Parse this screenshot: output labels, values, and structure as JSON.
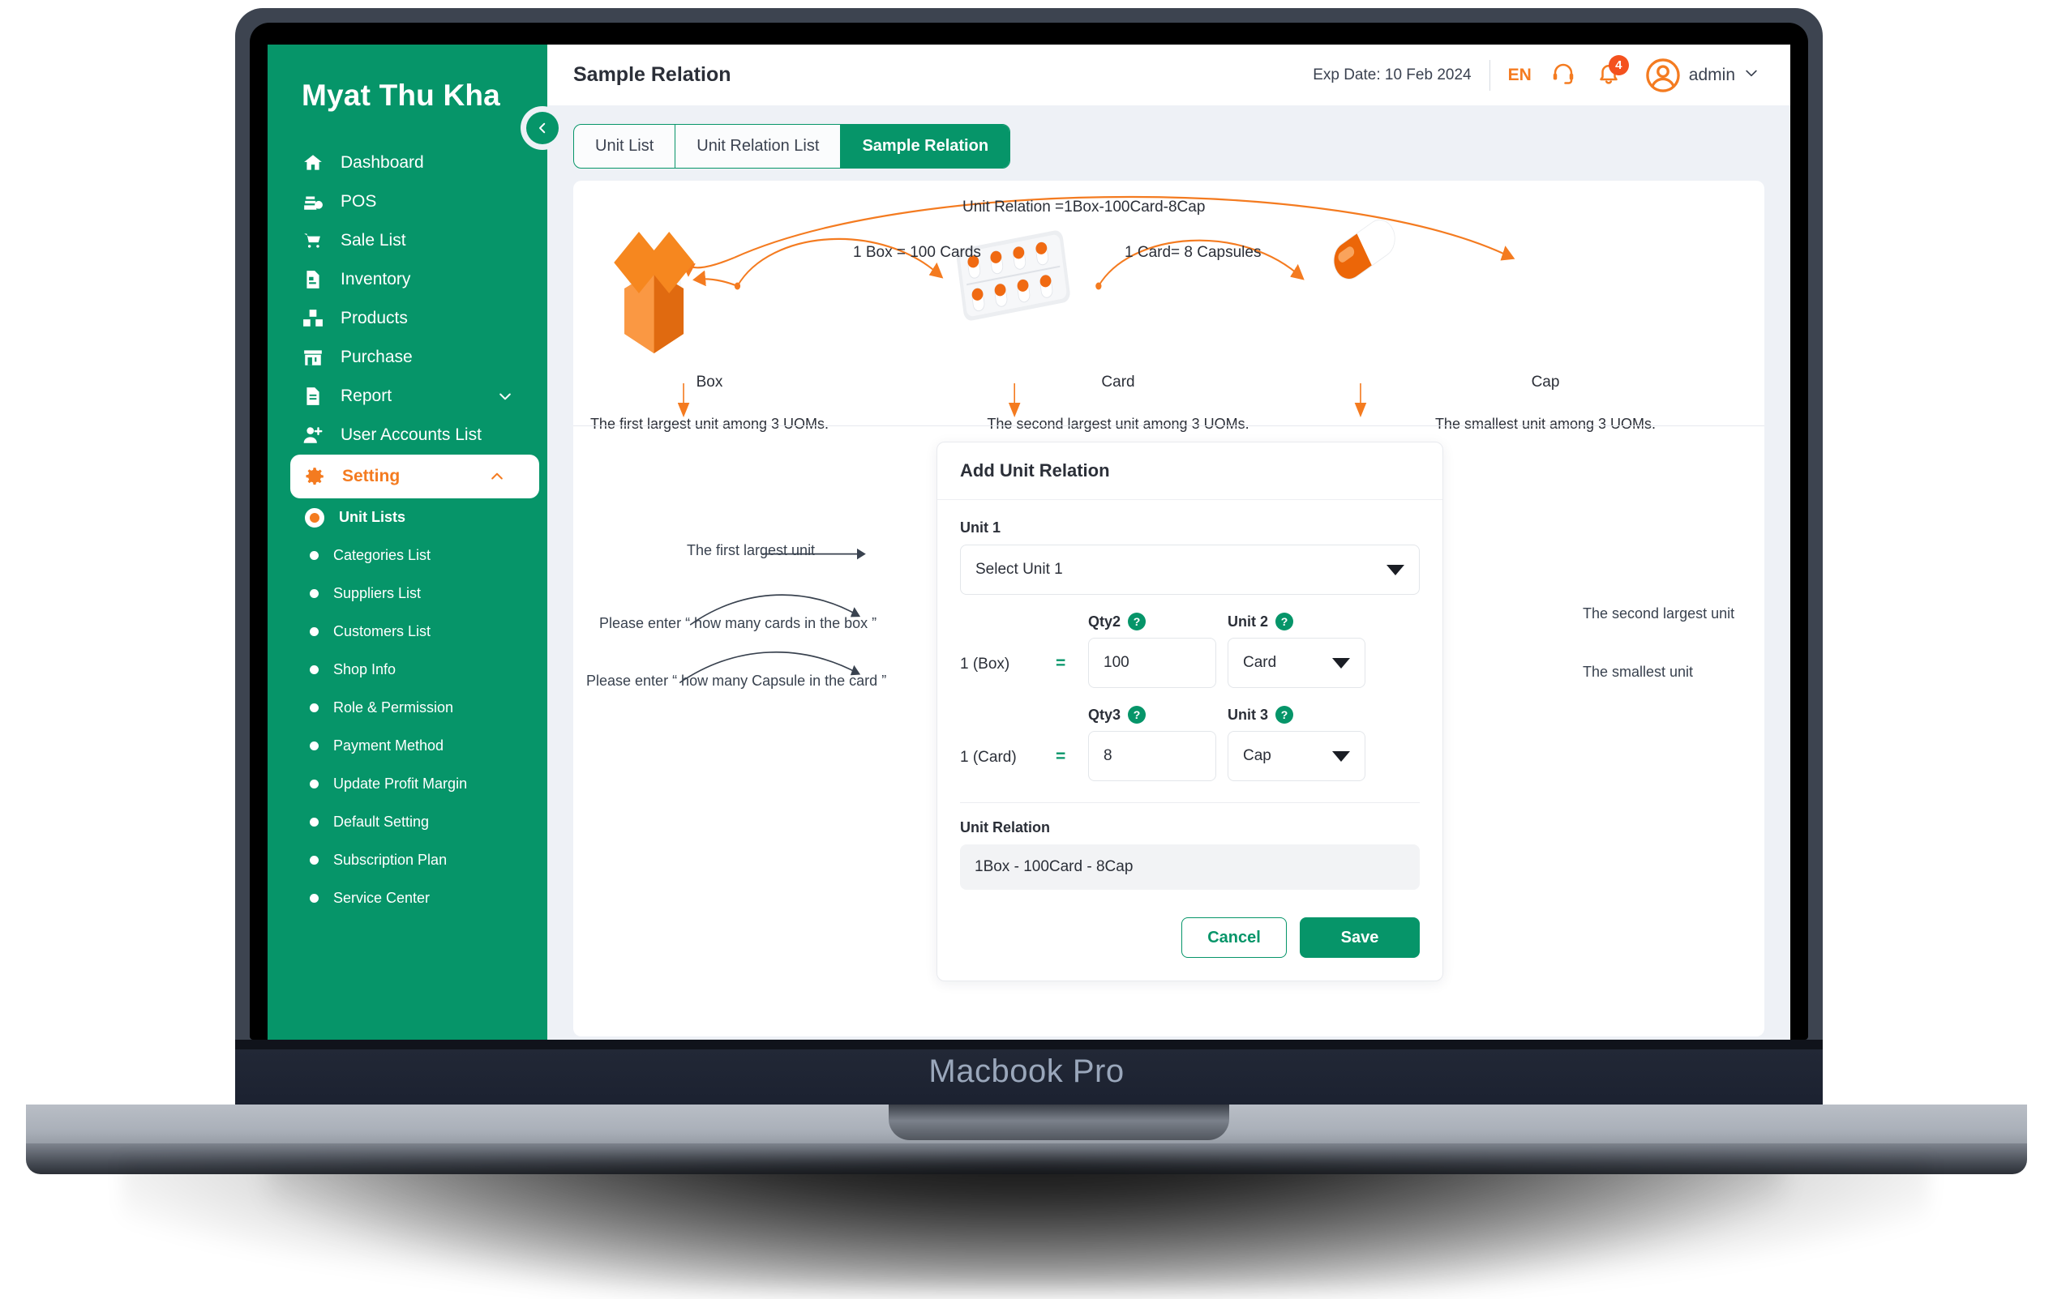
{
  "device": {
    "brand": "Macbook Pro"
  },
  "sidebar": {
    "brand": "Myat Thu Kha",
    "collapse_icon": "chevron-left-icon",
    "items": [
      {
        "label": "Dashboard",
        "icon": "home-icon"
      },
      {
        "label": "POS",
        "icon": "cash-register-icon"
      },
      {
        "label": "Sale List",
        "icon": "shopping-cart-icon"
      },
      {
        "label": "Inventory",
        "icon": "document-list-icon"
      },
      {
        "label": "Products",
        "icon": "boxes-icon"
      },
      {
        "label": "Purchase",
        "icon": "store-icon"
      },
      {
        "label": "Report",
        "icon": "file-text-icon",
        "chevron": "chevron-down-icon"
      },
      {
        "label": "User Accounts List",
        "icon": "user-plus-icon"
      }
    ],
    "active": {
      "label": "Setting",
      "icon": "gear-icon",
      "chevron": "chevron-up-icon"
    },
    "sub_items": [
      {
        "label": "Unit Lists",
        "current": true
      },
      {
        "label": "Categories List",
        "current": false
      },
      {
        "label": "Suppliers List",
        "current": false
      },
      {
        "label": "Customers List",
        "current": false
      },
      {
        "label": "Shop Info",
        "current": false
      },
      {
        "label": "Role & Permission",
        "current": false
      },
      {
        "label": "Payment Method",
        "current": false
      },
      {
        "label": "Update Profit Margin",
        "current": false
      },
      {
        "label": "Default Setting",
        "current": false
      },
      {
        "label": "Subscription Plan",
        "current": false
      },
      {
        "label": "Service Center",
        "current": false
      }
    ]
  },
  "topbar": {
    "title": "Sample Relation",
    "exp_date": "Exp Date: 10 Feb 2024",
    "language": "EN",
    "support_icon": "headset-icon",
    "notification_icon": "bell-icon",
    "notification_count": "4",
    "avatar_icon": "user-circle-icon",
    "user_name": "admin",
    "user_chevron": "chevron-down-icon"
  },
  "tabs": [
    {
      "label": "Unit List",
      "active": false
    },
    {
      "label": "Unit Relation List",
      "active": false
    },
    {
      "label": "Sample Relation",
      "active": true
    }
  ],
  "diagram": {
    "relation_summary": "Unit Relation =1Box-100Card-8Cap",
    "edge_box_to_card": "1 Box = 100 Cards",
    "edge_card_to_cap": "1 Card= 8 Capsules",
    "nodes": [
      {
        "name": "Box",
        "icon": "open-box-icon",
        "caption": "The first largest unit among 3 UOMs."
      },
      {
        "name": "Card",
        "icon": "blister-card-icon",
        "caption": "The second largest unit among 3 UOMs."
      },
      {
        "name": "Cap",
        "icon": "capsule-icon",
        "caption": "The smallest unit among 3 UOMs."
      }
    ]
  },
  "form": {
    "title": "Add Unit Relation",
    "unit1_label": "Unit 1",
    "unit1_placeholder": "Select Unit 1",
    "row2": {
      "left_text": "1 (Box)",
      "equals": "=",
      "qty_label": "Qty2",
      "qty_value": "100",
      "unit_label": "Unit 2",
      "unit_value": "Card",
      "help_glyph": "?"
    },
    "row3": {
      "left_text": "1 (Card)",
      "equals": "=",
      "qty_label": "Qty3",
      "qty_value": "8",
      "unit_label": "Unit 3",
      "unit_value": "Cap",
      "help_glyph": "?"
    },
    "relation_label": "Unit Relation",
    "relation_value": "1Box - 100Card - 8Cap",
    "cancel_label": "Cancel",
    "save_label": "Save"
  },
  "annotations": {
    "first_largest": "The first largest unit",
    "cards_in_box": "Please enter “ how many cards in the box ”",
    "capsule_in_card": "Please enter “ how many Capsule in the card ”",
    "second_largest": "The second largest unit",
    "smallest": "The smallest unit"
  },
  "colors": {
    "brand_green": "#069569",
    "accent_orange": "#F47B20",
    "badge_red": "#F4511E",
    "annotation_blue": "#39424f",
    "page_bg": "#eef1f6"
  }
}
